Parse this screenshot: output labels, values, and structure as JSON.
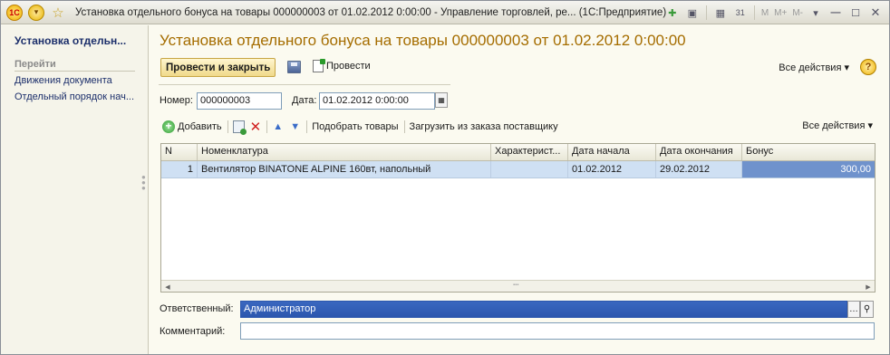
{
  "window": {
    "title": "Установка отдельного бонуса на товары 000000003 от 01.02.2012 0:00:00 - Управление торговлей, ре... (1С:Предприятие)",
    "app_logo": "1С",
    "m_buttons": [
      "M",
      "M+",
      "M-"
    ]
  },
  "sidebar": {
    "title": "Установка отдельн...",
    "group_label": "Перейти",
    "items": [
      {
        "label": "Движения документа"
      },
      {
        "label": "Отдельный порядок нач..."
      }
    ]
  },
  "form": {
    "title": "Установка отдельного бонуса на товары 000000003 от 01.02.2012 0:00:00",
    "post_close_label": "Провести и закрыть",
    "post_label": "Провести",
    "all_actions_label": "Все действия",
    "help_label": "?",
    "number_label": "Номер:",
    "number_value": "000000003",
    "date_label": "Дата:",
    "date_value": "01.02.2012  0:00:00",
    "responsible_label": "Ответственный:",
    "responsible_value": "Администратор",
    "comment_label": "Комментарий:",
    "comment_value": ""
  },
  "table_toolbar": {
    "add_label": "Добавить",
    "pick_label": "Подобрать товары",
    "load_label": "Загрузить из заказа поставщику",
    "all_actions_label": "Все действия"
  },
  "table": {
    "columns": [
      "N",
      "Номенклатура",
      "Характерист...",
      "Дата начала",
      "Дата окончания",
      "Бонус"
    ],
    "rows": [
      [
        "1",
        "Вентилятор BINATONE ALPINE 160вт, напольный",
        "",
        "01.02.2012",
        "29.02.2012",
        "300,00"
      ]
    ]
  },
  "colors": {
    "accent_title": "#a56d00",
    "selection": "#6f92cc",
    "row_highlight": "#cfe0f3"
  },
  "icons": [
    "logo-icon",
    "menu-circle-icon",
    "favorites-star-icon",
    "add-favorite-icon",
    "history-icon",
    "calculator-icon",
    "calendar-icon",
    "save-icon",
    "post-icon",
    "add-icon",
    "copy-icon",
    "delete-icon",
    "arrow-up-icon",
    "arrow-down-icon",
    "help-icon",
    "search-icon"
  ]
}
